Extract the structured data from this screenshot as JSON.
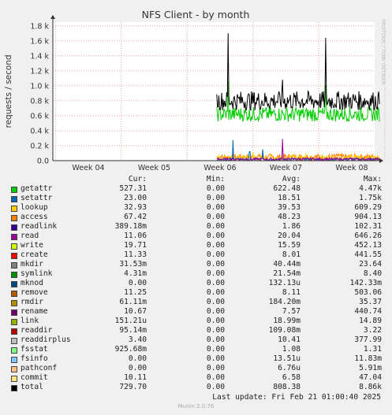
{
  "chart_data": {
    "type": "line",
    "title": "NFS Client - by month",
    "ylabel": "requests / second",
    "side_label": "RRDTOOL / TOBI OETIKER",
    "x_ticks": [
      "Week 04",
      "Week 05",
      "Week 06",
      "Week 07",
      "Week 08"
    ],
    "y_ticks": [
      "0.0",
      "0.2 k",
      "0.4 k",
      "0.6 k",
      "0.8 k",
      "1.0 k",
      "1.2 k",
      "1.4 k",
      "1.6 k",
      "1.8 k"
    ],
    "ylim": [
      0,
      1850
    ],
    "data_start_week": 5.95,
    "series": [
      {
        "name": "total",
        "color": "#000000",
        "approx_level": 800,
        "spikes": [
          [
            6.12,
            1700
          ],
          [
            7.6,
            1640
          ],
          [
            6.95,
            1080
          ]
        ]
      },
      {
        "name": "getattr",
        "color": "#00cc00",
        "approx_level": 620,
        "spikes": [
          [
            6.12,
            1050
          ],
          [
            7.6,
            1010
          ]
        ]
      },
      {
        "name": "read",
        "color": "#990099",
        "approx_level": 20,
        "spikes": [
          [
            6.95,
            290
          ]
        ]
      },
      {
        "name": "setattr",
        "color": "#0066b3",
        "approx_level": 18,
        "spikes": [
          [
            6.2,
            275
          ],
          [
            6.65,
            150
          ],
          [
            6.45,
            120
          ]
        ]
      },
      {
        "name": "lookup",
        "color": "#ffcc00",
        "approx_level": 40,
        "spikes": [
          [
            6.5,
            110
          ],
          [
            7.3,
            100
          ]
        ]
      },
      {
        "name": "access",
        "color": "#ff8000",
        "approx_level": 48,
        "spikes": [
          [
            7.8,
            90
          ]
        ]
      }
    ]
  },
  "legend": {
    "headers": {
      "cur": "Cur:",
      "min": "Min:",
      "avg": "Avg:",
      "max": "Max:"
    },
    "rows": [
      {
        "name": "getattr",
        "color": "#00cc00",
        "cur": "527.31",
        "min": "0.00",
        "avg": "622.48",
        "max": "4.47k"
      },
      {
        "name": "setattr",
        "color": "#0066b3",
        "cur": "23.00",
        "min": "0.00",
        "avg": "18.51",
        "max": "1.75k"
      },
      {
        "name": "lookup",
        "color": "#ffcc00",
        "cur": "32.93",
        "min": "0.00",
        "avg": "39.53",
        "max": "609.29"
      },
      {
        "name": "access",
        "color": "#ff8000",
        "cur": "67.42",
        "min": "0.00",
        "avg": "48.23",
        "max": "904.13"
      },
      {
        "name": "readlink",
        "color": "#330099",
        "cur": "389.18m",
        "min": "0.00",
        "avg": "1.86",
        "max": "102.31"
      },
      {
        "name": "read",
        "color": "#990099",
        "cur": "11.06",
        "min": "0.00",
        "avg": "20.04",
        "max": "646.26"
      },
      {
        "name": "write",
        "color": "#ccff00",
        "cur": "19.71",
        "min": "0.00",
        "avg": "15.59",
        "max": "452.13"
      },
      {
        "name": "create",
        "color": "#ff0000",
        "cur": "11.33",
        "min": "0.00",
        "avg": "8.01",
        "max": "441.55"
      },
      {
        "name": "mkdir",
        "color": "#808080",
        "cur": "31.53m",
        "min": "0.00",
        "avg": "40.44m",
        "max": "23.64"
      },
      {
        "name": "symlink",
        "color": "#008f00",
        "cur": "4.31m",
        "min": "0.00",
        "avg": "21.54m",
        "max": "8.40"
      },
      {
        "name": "mknod",
        "color": "#00487d",
        "cur": "0.00",
        "min": "0.00",
        "avg": "132.13u",
        "max": "142.33m"
      },
      {
        "name": "remove",
        "color": "#b35a00",
        "cur": "11.25",
        "min": "0.00",
        "avg": "8.11",
        "max": "503.06"
      },
      {
        "name": "rmdir",
        "color": "#b38f00",
        "cur": "61.11m",
        "min": "0.00",
        "avg": "184.20m",
        "max": "35.37"
      },
      {
        "name": "rename",
        "color": "#6b006b",
        "cur": "10.67",
        "min": "0.00",
        "avg": "7.57",
        "max": "440.74"
      },
      {
        "name": "link",
        "color": "#8fb300",
        "cur": "151.21u",
        "min": "0.00",
        "avg": "18.99m",
        "max": "14.89"
      },
      {
        "name": "readdir",
        "color": "#b30000",
        "cur": "95.14m",
        "min": "0.00",
        "avg": "109.08m",
        "max": "3.22"
      },
      {
        "name": "readdirplus",
        "color": "#bebebe",
        "cur": "3.40",
        "min": "0.00",
        "avg": "10.41",
        "max": "377.99"
      },
      {
        "name": "fsstat",
        "color": "#80ff80",
        "cur": "925.68m",
        "min": "0.00",
        "avg": "1.08",
        "max": "1.31"
      },
      {
        "name": "fsinfo",
        "color": "#80c9ff",
        "cur": "0.00",
        "min": "0.00",
        "avg": "13.51u",
        "max": "11.83m"
      },
      {
        "name": "pathconf",
        "color": "#ffc080",
        "cur": "0.00",
        "min": "0.00",
        "avg": "6.76u",
        "max": "5.91m"
      },
      {
        "name": "commit",
        "color": "#ffe680",
        "cur": "10.11",
        "min": "0.00",
        "avg": "6.58",
        "max": "47.04"
      },
      {
        "name": "total",
        "color": "#000000",
        "cur": "729.70",
        "min": "0.00",
        "avg": "808.38",
        "max": "8.86k"
      }
    ]
  },
  "last_update": "Last update:  Fri Feb 21 01:00:40 2025",
  "munin_version": "Munin 2.0.76"
}
